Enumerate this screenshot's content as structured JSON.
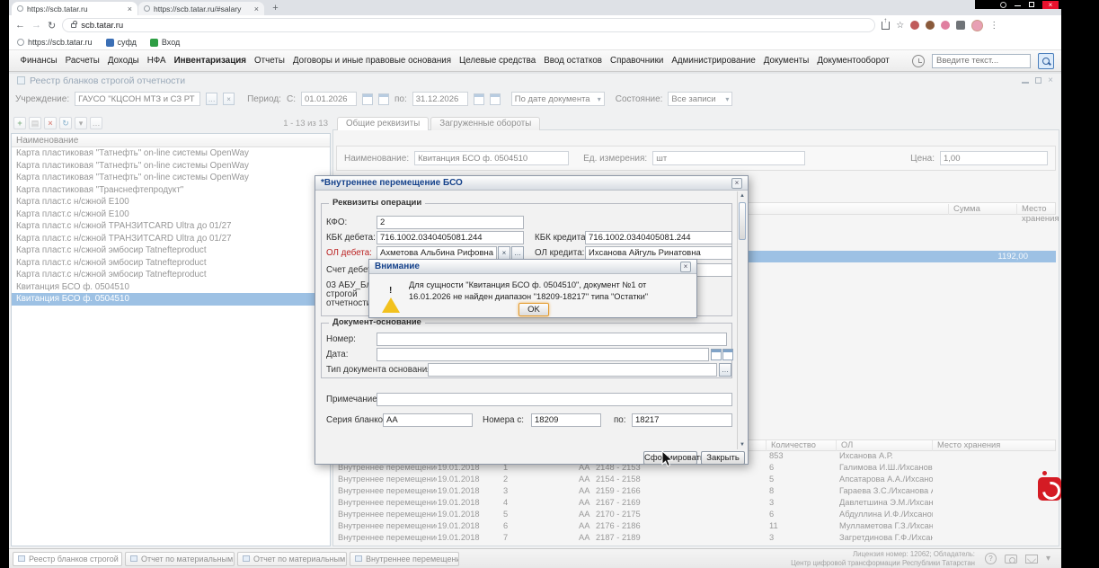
{
  "browser": {
    "tabs": [
      {
        "title": "https://scb.tatar.ru"
      },
      {
        "title": "https://scb.tatar.ru/#salary"
      }
    ],
    "address": "scb.tatar.ru",
    "bookmarks": [
      {
        "label": "https://scb.tatar.ru"
      },
      {
        "label": "суфд"
      },
      {
        "label": "Вход"
      }
    ]
  },
  "menubar": {
    "items": [
      "Финансы",
      "Расчеты",
      "Доходы",
      "НФА",
      "Инвентаризация",
      "Отчеты",
      "Договоры и иные правовые основания",
      "Целевые средства",
      "Ввод остатков",
      "Справочники",
      "Администрирование",
      "Документы",
      "Документооборот"
    ],
    "search_placeholder": "Введите текст..."
  },
  "window": {
    "title": "Реестр бланков строгой отчетности"
  },
  "filters": {
    "institution_label": "Учреждение:",
    "institution_value": "ГАУСО \"КЦСОН МТЗ и СЗ РТ в М",
    "period_label": "Период:",
    "from_label": "С:",
    "from_value": "01.01.2026",
    "to_label": "по:",
    "to_value": "31.12.2026",
    "date_mode_value": "По дате документа",
    "state_label": "Состояние:",
    "state_value": "Все записи"
  },
  "list_panel": {
    "pagination": "1 - 13 из 13",
    "column_header": "Наименование",
    "items": [
      "Карта пластиковая \"Татнефть\" on-line системы OpenWay",
      "Карта пластиковая \"Татнефть\" on-line системы OpenWay",
      "Карта пластиковая \"Татнефть\" on-line системы OpenWay",
      "Карта пластиковая \"Транснефтепродукт\"",
      "Карта пласт.с н/сжной Е100",
      "Карта пласт.с н/сжной Е100",
      "Карта пласт.с н/сжной ТРАНЗИТCARD Ultra до 01/27",
      "Карта пласт.с н/сжной ТРАНЗИТCARD Ultra до 01/27",
      "Карта пласт.с н/сжной эмбосир Tatnefteproduct",
      "Карта пласт.с н/сжной эмбосир Tatnefteproduct",
      "Карта пласт.с н/сжной эмбосир Tatnefteproduct",
      "Квитанция БСО ф. 0504510",
      "Квитанция БСО ф. 0504510"
    ]
  },
  "detail": {
    "tab1": "Общие реквизиты",
    "tab2": "Загруженные обороты",
    "name_label": "Наименование:",
    "name_value": "Квитанция БСО ф. 0504510",
    "unit_label": "Ед. измерения:",
    "unit_value": "шт",
    "price_label": "Цена:",
    "price_value": "1,00",
    "mid_grid": {
      "sum_header": "Сумма",
      "place_header": "Место хранения",
      "selected_sum": "1192,00"
    },
    "bottom_grid": {
      "qty_header": "Количество",
      "ol_header": "ОЛ",
      "place_header": "Место хранения",
      "rows": [
        {
          "name": "",
          "date": "",
          "num": "",
          "series": "",
          "range": "",
          "qty": "853",
          "ol": "Ихсанова А.Р.",
          "place": ""
        },
        {
          "name": "Внутреннее перемещение БСО",
          "date": "19.01.2018",
          "num": "1",
          "series": "АА",
          "range": "2148 - 2153",
          "qty": "6",
          "ol": "Галимова И.Ш./Ихсанова А.Р.",
          "place": ""
        },
        {
          "name": "Внутреннее перемещение БСО",
          "date": "19.01.2018",
          "num": "2",
          "series": "АА",
          "range": "2154 - 2158",
          "qty": "5",
          "ol": "Апсатарова А.А./Ихсанова А.Р.",
          "place": ""
        },
        {
          "name": "Внутреннее перемещение БСО",
          "date": "19.01.2018",
          "num": "3",
          "series": "АА",
          "range": "2159 - 2166",
          "qty": "8",
          "ol": "Гараева З.С./Ихсанова А.Р.",
          "place": ""
        },
        {
          "name": "Внутреннее перемещение БСО",
          "date": "19.01.2018",
          "num": "4",
          "series": "АА",
          "range": "2167 - 2169",
          "qty": "3",
          "ol": "Давлетшина Э.М./Ихсанова А.",
          "place": ""
        },
        {
          "name": "Внутреннее перемещение БСО",
          "date": "19.01.2018",
          "num": "5",
          "series": "АА",
          "range": "2170 - 2175",
          "qty": "6",
          "ol": "Абдуллина И.Ф./Ихсанова А.Р.",
          "place": ""
        },
        {
          "name": "Внутреннее перемещение БСО",
          "date": "19.01.2018",
          "num": "6",
          "series": "АА",
          "range": "2176 - 2186",
          "qty": "11",
          "ol": "Мулламетова Г.З./Ихсанова",
          "place": ""
        },
        {
          "name": "Внутреннее перемещение БСО",
          "date": "19.01.2018",
          "num": "7",
          "series": "АА",
          "range": "2187 - 2189",
          "qty": "3",
          "ol": "Загретдинова Г.Ф./Ихсанова",
          "place": ""
        }
      ]
    }
  },
  "modal": {
    "title": "*Внутреннее перемещение БСО",
    "fieldset1_legend": "Реквизиты операции",
    "kfo_label": "КФО:",
    "kfo_value": "2",
    "kbk_debit_label": "КБК дебета:",
    "kbk_debit_value": "716.1002.0340405081.244",
    "kbk_credit_label": "КБК кредита:",
    "kbk_credit_value": "716.1002.0340405081.244",
    "ol_debit_label": "ОЛ дебета:",
    "ol_debit_value": "Ахметова Альбина Рифовна",
    "ol_credit_label": "ОЛ кредита:",
    "ol_credit_value": "Ихсанова Айгуль Ринатовна",
    "account_debit_label": "Счет дебета:",
    "abu_label_1": "03 АБУ_Бланки",
    "abu_label_2": "строгой",
    "abu_label_3": "отчетности:",
    "fieldset2_legend": "Документ-основание",
    "number_label": "Номер:",
    "date_label": "Дата:",
    "doc_type_label": "Тип документа основания:",
    "note_label": "Примечание:",
    "series_label": "Серия бланков:",
    "series_value": "АА",
    "num_from_label": "Номера с:",
    "num_from_value": "18209",
    "num_to_label": "по:",
    "num_to_value": "18217",
    "generate_button": "Сформировать",
    "close_button": "Закрыть"
  },
  "alert": {
    "title": "Внимание",
    "message": "Для сущности \"Квитанция БСО ф. 0504510\", документ №1 от 16.01.2026 не найден диапазон \"18209-18217\" типа \"Остатки\"",
    "ok_button": "OK"
  },
  "taskbar": {
    "tabs": [
      "Реестр бланков строгой",
      "Отчет по материальным запасам",
      "Отчет по материальным запа...",
      "Внутреннее перемещение БСО"
    ],
    "license_line1": "Лицензия номер: 12062; Обладатель:",
    "license_line2": "Центр цифровой трансформации Республики Татарстан"
  }
}
